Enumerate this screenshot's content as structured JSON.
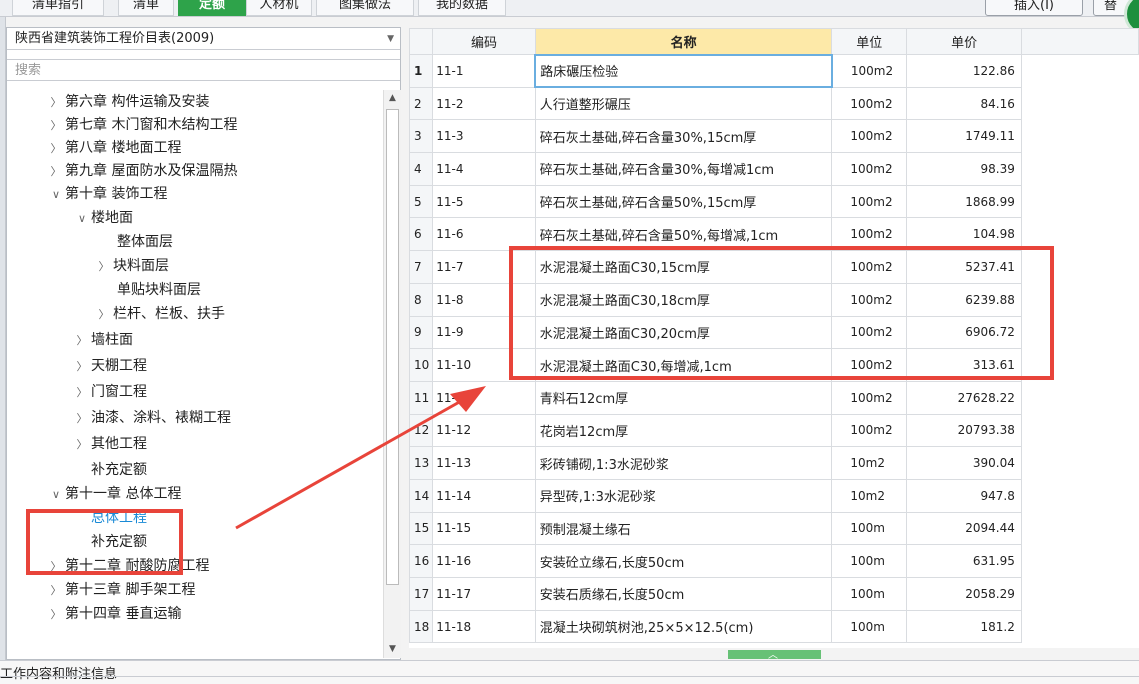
{
  "tabs": [
    {
      "label": "清单指引"
    },
    {
      "label": "清单"
    },
    {
      "label": "定额"
    },
    {
      "label": "人材机"
    },
    {
      "label": "图集做法"
    },
    {
      "label": "我的数据"
    }
  ],
  "toolbar": {
    "insert_label": "插入(I)",
    "more_label": "替"
  },
  "left": {
    "catalog": "陕西省建筑装饰工程价目表(2009)",
    "search_placeholder": "搜索",
    "tree": [
      "第六章 构件运输及安装",
      "第七章 木门窗和木结构工程",
      "第八章 楼地面工程",
      "第九章 屋面防水及保温隔热",
      "第十章 装饰工程",
      "楼地面",
      "整体面层",
      "块料面层",
      "单贴块料面层",
      "栏杆、栏板、扶手",
      "墙柱面",
      "天棚工程",
      "门窗工程",
      "油漆、涂料、裱糊工程",
      "其他工程",
      "补充定额",
      "第十一章 总体工程",
      "总体工程",
      "补充定额",
      "第十二章 耐酸防腐工程",
      "第十三章 脚手架工程",
      "第十四章 垂直运输"
    ]
  },
  "grid": {
    "headers": {
      "code": "编码",
      "name": "名称",
      "unit": "单位",
      "price": "单价"
    },
    "rows": [
      {
        "no": "1",
        "code": "11-1",
        "name": "路床碾压检验",
        "unit": "100m2",
        "price": "122.86"
      },
      {
        "no": "2",
        "code": "11-2",
        "name": "人行道整形碾压",
        "unit": "100m2",
        "price": "84.16"
      },
      {
        "no": "3",
        "code": "11-3",
        "name": "碎石灰土基础,碎石含量30%,15cm厚",
        "unit": "100m2",
        "price": "1749.11"
      },
      {
        "no": "4",
        "code": "11-4",
        "name": "碎石灰土基础,碎石含量30%,每增减1cm",
        "unit": "100m2",
        "price": "98.39"
      },
      {
        "no": "5",
        "code": "11-5",
        "name": "碎石灰土基础,碎石含量50%,15cm厚",
        "unit": "100m2",
        "price": "1868.99"
      },
      {
        "no": "6",
        "code": "11-6",
        "name": "碎石灰土基础,碎石含量50%,每增减,1cm",
        "unit": "100m2",
        "price": "104.98"
      },
      {
        "no": "7",
        "code": "11-7",
        "name": "水泥混凝土路面C30,15cm厚",
        "unit": "100m2",
        "price": "5237.41"
      },
      {
        "no": "8",
        "code": "11-8",
        "name": "水泥混凝土路面C30,18cm厚",
        "unit": "100m2",
        "price": "6239.88"
      },
      {
        "no": "9",
        "code": "11-9",
        "name": "水泥混凝土路面C30,20cm厚",
        "unit": "100m2",
        "price": "6906.72"
      },
      {
        "no": "10",
        "code": "11-10",
        "name": "水泥混凝土路面C30,每增减,1cm",
        "unit": "100m2",
        "price": "313.61"
      },
      {
        "no": "11",
        "code": "11-11",
        "name": "青料石12cm厚",
        "unit": "100m2",
        "price": "27628.22"
      },
      {
        "no": "12",
        "code": "11-12",
        "name": "花岗岩12cm厚",
        "unit": "100m2",
        "price": "20793.38"
      },
      {
        "no": "13",
        "code": "11-13",
        "name": "彩砖铺砌,1:3水泥砂浆",
        "unit": "10m2",
        "price": "390.04"
      },
      {
        "no": "14",
        "code": "11-14",
        "name": "异型砖,1:3水泥砂浆",
        "unit": "10m2",
        "price": "947.8"
      },
      {
        "no": "15",
        "code": "11-15",
        "name": "预制混凝土缘石",
        "unit": "100m",
        "price": "2094.44"
      },
      {
        "no": "16",
        "code": "11-16",
        "name": "安装砼立缘石,长度50cm",
        "unit": "100m",
        "price": "631.95"
      },
      {
        "no": "17",
        "code": "11-17",
        "name": "安装石质缘石,长度50cm",
        "unit": "100m",
        "price": "2058.29"
      },
      {
        "no": "18",
        "code": "11-18",
        "name": "混凝土块砌筑树池,25×5×12.5(cm)",
        "unit": "100m",
        "price": "181.2"
      }
    ]
  },
  "bottom": {
    "title": "工作内容和附注信息"
  },
  "colors": {
    "accent": "#2ea34a",
    "highlight_red": "#e8443a",
    "selected_text": "#1a8ad6",
    "name_header": "#fde9a8"
  }
}
